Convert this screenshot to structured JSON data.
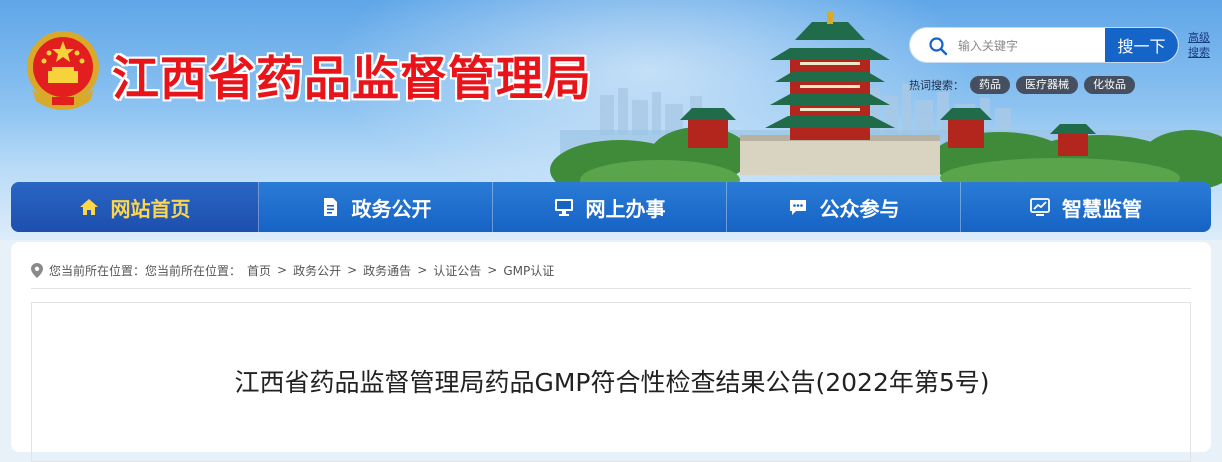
{
  "header": {
    "site_title": "江西省药品监督管理局",
    "search": {
      "placeholder": "输入关键字",
      "button_label": "搜一下",
      "advanced_label": "高级搜索"
    },
    "hot_search": {
      "label": "热词搜索：",
      "items": [
        "药品",
        "医疗器械",
        "化妆品"
      ]
    }
  },
  "nav": {
    "items": [
      {
        "label": "网站首页",
        "icon": "home-icon",
        "active": true
      },
      {
        "label": "政务公开",
        "icon": "document-icon",
        "active": false
      },
      {
        "label": "网上办事",
        "icon": "monitor-icon",
        "active": false
      },
      {
        "label": "公众参与",
        "icon": "chat-icon",
        "active": false
      },
      {
        "label": "智慧监管",
        "icon": "screen-chart-icon",
        "active": false
      }
    ]
  },
  "breadcrumb": {
    "prefix": "您当前所在位置：您当前所在位置：",
    "items": [
      "首页",
      "政务公开",
      "政务通告",
      "认证公告",
      "GMP认证"
    ],
    "separator": ">"
  },
  "article": {
    "title": "江西省药品监督管理局药品GMP符合性检查结果公告(2022年第5号)"
  },
  "colors": {
    "title_red": "#e8141a",
    "nav_blue": "#1663c4",
    "nav_active_text": "#ffd64a",
    "search_button": "#1565c8"
  }
}
